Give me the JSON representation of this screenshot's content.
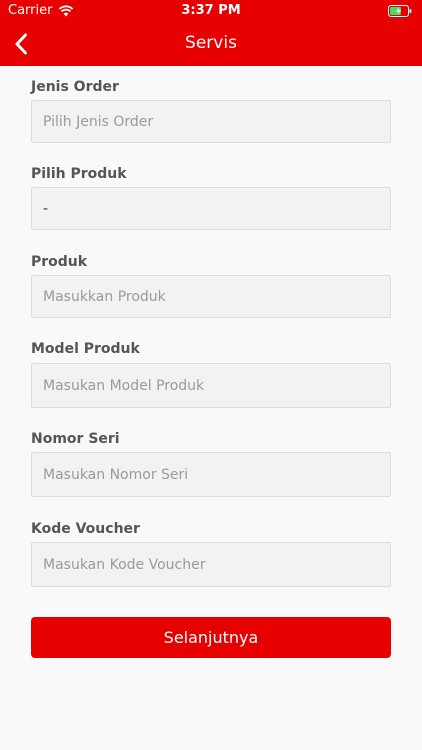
{
  "status_bar": {
    "carrier": "Carrier",
    "time": "3:37 PM",
    "wifi_icon": "wifi-icon",
    "battery_icon": "battery-charging-icon"
  },
  "nav": {
    "title": "Servis",
    "back_icon": "chevron-left-icon"
  },
  "form": {
    "fields": [
      {
        "label": "Jenis Order",
        "placeholder": "Pilih Jenis Order",
        "value": ""
      },
      {
        "label": "Pilih Produk",
        "placeholder": "",
        "value": "-"
      },
      {
        "label": "Produk",
        "placeholder": "Masukkan Produk",
        "value": ""
      },
      {
        "label": "Model Produk",
        "placeholder": "Masukan Model Produk",
        "value": ""
      },
      {
        "label": "Nomor Seri",
        "placeholder": "Masukan Nomor Seri",
        "value": ""
      },
      {
        "label": "Kode Voucher",
        "placeholder": "Masukan Kode Voucher",
        "value": ""
      }
    ]
  },
  "next_button": {
    "label": "Selanjutnya"
  },
  "colors": {
    "brand_red": "#e60000",
    "background": "#f9f9f9",
    "field_bg": "#f2f2f2",
    "label": "#555555",
    "placeholder": "#9a9a9a"
  }
}
